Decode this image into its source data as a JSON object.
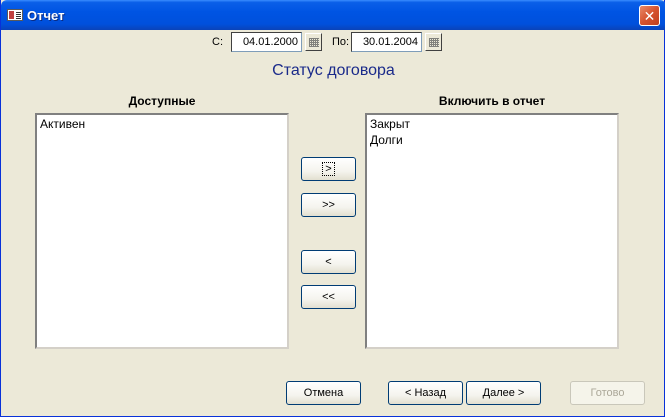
{
  "window": {
    "title": "Отчет"
  },
  "dates": {
    "from_label": "С:",
    "from_value": "04.01.2000",
    "to_label": "По:",
    "to_value": "30.01.2004"
  },
  "heading": "Статус договора",
  "available": {
    "title": "Доступные",
    "items": [
      "Активен"
    ]
  },
  "included": {
    "title": "Включить в отчет",
    "items": [
      "Закрыт",
      "Долги"
    ]
  },
  "move_buttons": {
    "add_one": ">",
    "add_all": ">>",
    "remove_one": "<",
    "remove_all": "<<"
  },
  "footer": {
    "cancel": "Отмена",
    "back": "< Назад",
    "next": "Далее >",
    "finish": "Готово"
  }
}
